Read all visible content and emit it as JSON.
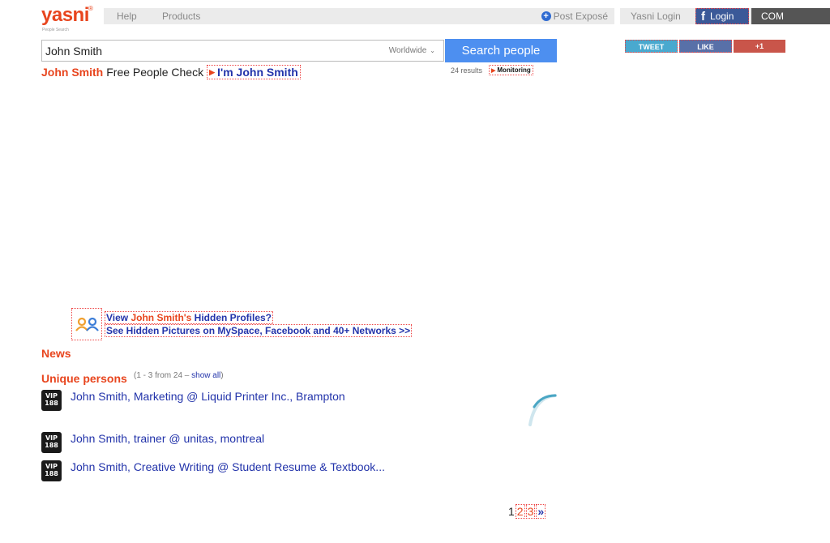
{
  "header": {
    "logo": "yasni",
    "logo_reg": "®",
    "logo_tagline": "People Search",
    "nav": [
      {
        "label": "Help"
      },
      {
        "label": "Products"
      }
    ],
    "post_expose": "Post Exposé",
    "yasni_login": "Yasni Login",
    "fb_login": "Login",
    "fb_letter": "f",
    "com": "COM"
  },
  "search": {
    "value": "John Smith",
    "region": "Worldwide",
    "button": "Search people"
  },
  "share": {
    "tweet": "TWEET",
    "like": "LIKE",
    "plus": "+1"
  },
  "subline": {
    "name": "John Smith",
    "text": "Free People Check",
    "im_button": "I'm John Smith",
    "results": "24 results",
    "monitoring": "Monitoring"
  },
  "hidden_profiles": {
    "line1_prefix": "View ",
    "line1_name": "John Smith's",
    "line1_suffix": " Hidden Profiles?",
    "line2": "See Hidden Pictures on MySpace, Facebook and 40+ Networks >>"
  },
  "sections": {
    "news": "News",
    "unique": "Unique persons",
    "unique_meta": "(1 - 3 from 24  –  ",
    "show_all": "show all",
    "unique_meta_close": ")"
  },
  "results": [
    {
      "text": "John Smith, Marketing @ Liquid Printer Inc., Brampton",
      "vip_top": "VIP",
      "vip_num": "188"
    },
    {
      "text": "John Smith, trainer @ unitas, montreal",
      "vip_top": "VIP",
      "vip_num": "188"
    },
    {
      "text": "John Smith, Creative Writing @ Student Resume & Textbook...",
      "vip_top": "VIP",
      "vip_num": "188"
    }
  ],
  "pagination": {
    "current": "1",
    "page2": "2",
    "page3": "3",
    "next": "»"
  },
  "colors": {
    "brand": "#e8451e",
    "link": "#2233aa",
    "search_button": "#4d8ff0"
  }
}
